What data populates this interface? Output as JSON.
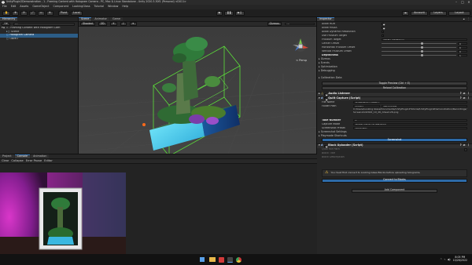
{
  "titlebar": {
    "title": "UnityPlugin2Demonstration - 1 - Framing Content with Hologram Camera - PC, Mac & Linux Standalone - Unity 2020.3.30f1 (Personal) <DX11>"
  },
  "menu": [
    "File",
    "Edit",
    "Assets",
    "GameObject",
    "Component",
    "LookingGlass",
    "Tutorial",
    "Window",
    "Help"
  ],
  "toolbar": {
    "pivot": "Pivot",
    "space": "Local",
    "account": "Account",
    "layers": "Layers",
    "layout": "Layout"
  },
  "hierarchy": {
    "tab": "Hierarchy",
    "search_placeholder": "All",
    "items": [
      "1 - Framing Content with Hologram Cam",
      "Scene",
      "Hologram Camera",
      "OBMO"
    ]
  },
  "scene": {
    "tabs": [
      "Scene",
      "Animator",
      "Game"
    ],
    "shading": "Shaded",
    "mode": "2D",
    "gizmos": "Gizmos",
    "search_placeholder": "All",
    "persp": "< Persp"
  },
  "bottom": {
    "tabs": [
      "Project",
      "Console",
      "Animation"
    ],
    "console_buttons": [
      "Clear",
      "Collapse",
      "Error Pause",
      "Editor"
    ]
  },
  "inspector": {
    "tab": "Inspector",
    "camera_rows": [
      {
        "label": "Allow HDR",
        "checked": true
      },
      {
        "label": "Allow MSAA",
        "checked": true
      },
      {
        "label": "Allow Dynamic Resolution",
        "checked": false
      },
      {
        "label": "Use Frustum Target",
        "checked": false
      }
    ],
    "frustum_target": {
      "label": "Frustum Target",
      "value": "None (Transform)"
    },
    "sliders": [
      {
        "label": "Center Offset",
        "value": "0",
        "pos": 0.5
      },
      {
        "label": "Horizontal Frustum Offset",
        "value": "0",
        "pos": 0.5
      },
      {
        "label": "Vertical Frustum Offset",
        "value": "0",
        "pos": 0.5
      },
      {
        "label": "Depthiness",
        "value": "1",
        "pos": 0.5
      }
    ],
    "foldouts": [
      "Gizmos",
      "Events",
      "Optimization",
      "Debugging"
    ],
    "calibration": {
      "label": "Calibration Data",
      "toggle_button": "Toggle Preview (Ctrl + E)",
      "reload_button": "Reload Calibration"
    },
    "audio_listener": "Audio Listener",
    "quilt_capture": {
      "title": "Quilt Capture (Script)",
      "rows": [
        {
          "label": "File Name",
          "value": "Screenshot{{date}}"
        },
        {
          "label": "Folder Path",
          "value": "Project",
          "extra": "Recordings"
        }
      ],
      "path_text": "C:/Users/Looking Glass/Documents/UnityPlugin2Tutorial/UnityPlugin2Demonstration/Recordings/Screenshot2022_10_26_ddead.26.png",
      "take_number": {
        "label": "Take Number",
        "value": "0"
      },
      "capture_mode": {
        "label": "Capture Mode",
        "value": "Single Frame (Screenshot)"
      },
      "screenshot_preset": {
        "label": "Screenshot Preset",
        "value": "Automatic"
      },
      "settings_label": "Screenshot Settings",
      "shortcuts_label": "Playmode Shortcuts",
      "screenshot_button": "Screenshot"
    },
    "block_uploader": {
      "title": "Block Uploader (Script)",
      "rows": [
        {
          "label": "Quilt File Path",
          "value": ""
        },
        {
          "label": "Block Title",
          "value": ""
        },
        {
          "label": "Block Description",
          "value": ""
        }
      ],
      "warning": "You must first connect to Looking Glass Blocks before uploading holograms.",
      "connect_button": "Connect to Blocks"
    },
    "add_component": "Add Component"
  },
  "taskbar": {
    "time": "8:05 PM",
    "date": "10/26/2022"
  },
  "colors": {
    "accent": "#3a79bb",
    "selection": "#2c5d87",
    "scene_bg": "#3a3a3a",
    "bounds": "#5ce03a",
    "webcam_glow": "#c02ab8"
  }
}
